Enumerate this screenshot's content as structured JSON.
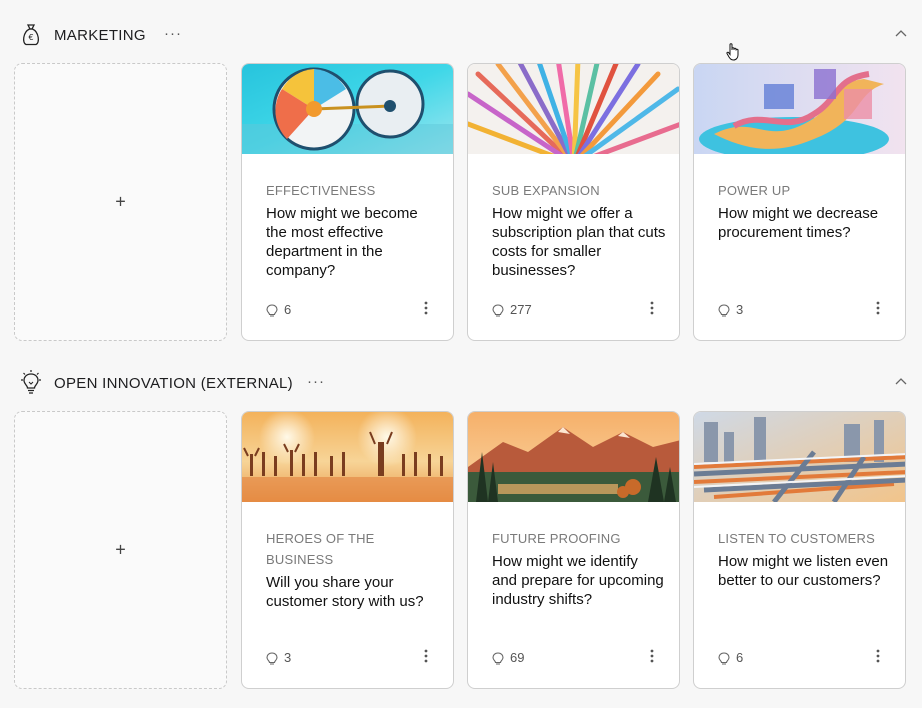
{
  "sections": [
    {
      "title": "MARKETING",
      "more": "···",
      "icon": "money-bag-euro-icon",
      "cards": [
        {
          "category": "EFFECTIVENESS",
          "question": "How might we become the most effective department in the company?",
          "count": "6"
        },
        {
          "category": "SUB EXPANSION",
          "question": "How might we offer a subscription plan that cuts costs for smaller businesses?",
          "count": "277"
        },
        {
          "category": "POWER UP",
          "question": "How might we decrease procurement times?",
          "count": "3"
        }
      ]
    },
    {
      "title": "OPEN INNOVATION (EXTERNAL)",
      "more": "···",
      "icon": "lightbulb-icon",
      "cards": [
        {
          "category": "HEROES OF THE BUSINESS",
          "question": "Will you share your customer story with us?",
          "count": "3"
        },
        {
          "category": "FUTURE PROOFING",
          "question": "How might we identify and prepare for upcoming industry shifts?",
          "count": "69"
        },
        {
          "category": "LISTEN TO CUSTOMERS",
          "question": "How might we listen even better to our customers?",
          "count": "6"
        }
      ]
    }
  ],
  "add_label": "+",
  "colors": {
    "accent_border": "#cfcfcf",
    "background": "#f7f7f7"
  }
}
